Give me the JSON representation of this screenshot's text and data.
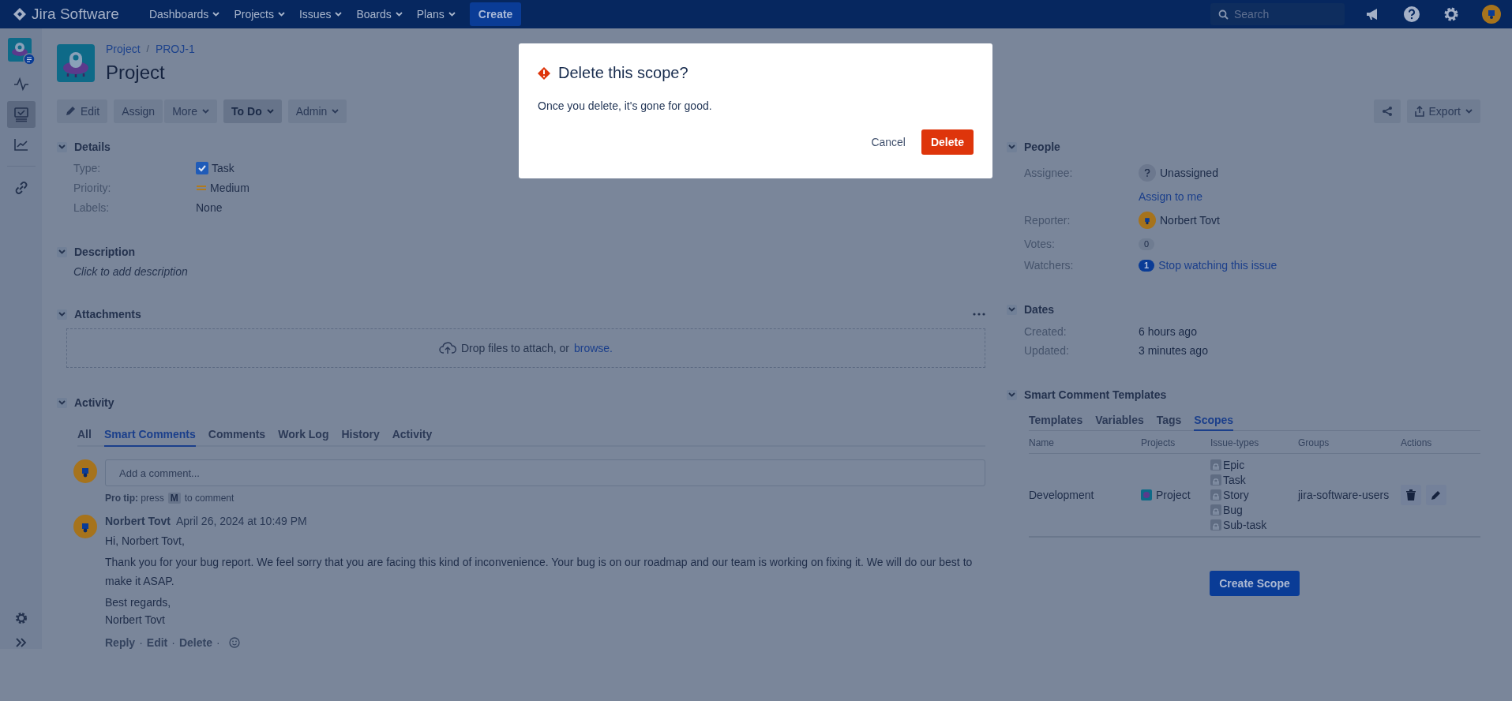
{
  "top_nav": {
    "logo": "Jira Software",
    "menus": [
      {
        "label": "Dashboards"
      },
      {
        "label": "Projects"
      },
      {
        "label": "Issues"
      },
      {
        "label": "Boards"
      },
      {
        "label": "Plans"
      }
    ],
    "create": "Create",
    "search": {
      "placeholder": "Search"
    }
  },
  "sidebar": {
    "items": [
      {
        "kind": "pulse",
        "selected": false
      },
      {
        "kind": "board",
        "selected": true
      },
      {
        "kind": "chart",
        "selected": false
      },
      {
        "kind": "link",
        "selected": false
      }
    ]
  },
  "issue": {
    "breadcrumb": [
      "Project",
      "PROJ-1"
    ],
    "separator": "/",
    "title": "Project"
  },
  "toolbar": {
    "buttons": [
      {
        "label": "Edit",
        "kind": "edit",
        "dropdown": false
      },
      {
        "label": "Assign",
        "kind": "plain",
        "dropdown": false
      },
      {
        "label": "More",
        "kind": "plain",
        "dropdown": true
      },
      {
        "label": "To Do",
        "kind": "status",
        "dropdown": true
      },
      {
        "label": "Admin",
        "kind": "plain",
        "dropdown": true
      }
    ],
    "export": "Export"
  },
  "details": {
    "title": "Details",
    "fields": [
      {
        "label": "Type:",
        "value": "Task",
        "kind": "task"
      },
      {
        "label": "Priority:",
        "value": "Medium",
        "kind": "priority"
      },
      {
        "label": "Labels:",
        "value": "None",
        "kind": "plain"
      }
    ]
  },
  "description": {
    "title": "Description",
    "placeholder": "Click to add description"
  },
  "attachments": {
    "title": "Attachments",
    "drop_text": "Drop files to attach, or",
    "browse": "browse."
  },
  "activity": {
    "title": "Activity",
    "tabs": [
      {
        "label": "All",
        "selected": false
      },
      {
        "label": "Smart Comments",
        "selected": true
      },
      {
        "label": "Comments",
        "selected": false
      },
      {
        "label": "Work Log",
        "selected": false
      },
      {
        "label": "History",
        "selected": false
      },
      {
        "label": "Activity",
        "selected": false
      }
    ],
    "comment_box": {
      "placeholder": "Add a comment..."
    },
    "pro_tip": {
      "before": "**Pro tip:** press",
      "key": "M",
      "after": "to comment"
    },
    "comment": {
      "author": "Norbert Tovt",
      "date": "April 26, 2024 at 10:49 PM",
      "lines": [
        "Hi, Norbert Tovt,",
        "Thank you for your bug report. We feel sorry that you are facing this kind of inconvenience. Your bug is on our roadmap and our team is working on fixing it. We will do our best to make it ASAP.",
        "Best regards,",
        "Norbert Tovt"
      ],
      "actions": [
        "Reply",
        "Edit",
        "Delete"
      ],
      "separator": "·"
    }
  },
  "people": {
    "title": "People",
    "assignee_label": "Assignee:",
    "assignee": "Unassigned",
    "assign_to_me": "Assign to me",
    "reporter_label": "Reporter:",
    "reporter": "Norbert Tovt",
    "votes_label": "Votes:",
    "votes": "0",
    "watchers_label": "Watchers:",
    "watchers": "1",
    "stop_watching": "Stop watching this issue"
  },
  "dates": {
    "title": "Dates",
    "fields": [
      {
        "label": "Created:",
        "value": "6 hours ago"
      },
      {
        "label": "Updated:",
        "value": "3 minutes ago"
      }
    ]
  },
  "smart_templates": {
    "title": "Smart Comment Templates",
    "tabs": [
      {
        "label": "Templates",
        "selected": false
      },
      {
        "label": "Variables",
        "selected": false
      },
      {
        "label": "Tags",
        "selected": false
      },
      {
        "label": "Scopes",
        "selected": true
      }
    ],
    "columns": [
      "Name",
      "Projects",
      "Issue-types",
      "Groups",
      "Actions"
    ],
    "rows": [
      {
        "name": "Development",
        "project": "Project",
        "issue_types": [
          "Epic",
          "Task",
          "Story",
          "Bug",
          "Sub-task"
        ],
        "group": "jira-software-users"
      }
    ],
    "create_button": "Create Scope"
  },
  "dialog": {
    "title": "Delete this scope?",
    "body": "Once you delete, it's gone for good.",
    "cancel": "Cancel",
    "confirm": "Delete"
  }
}
